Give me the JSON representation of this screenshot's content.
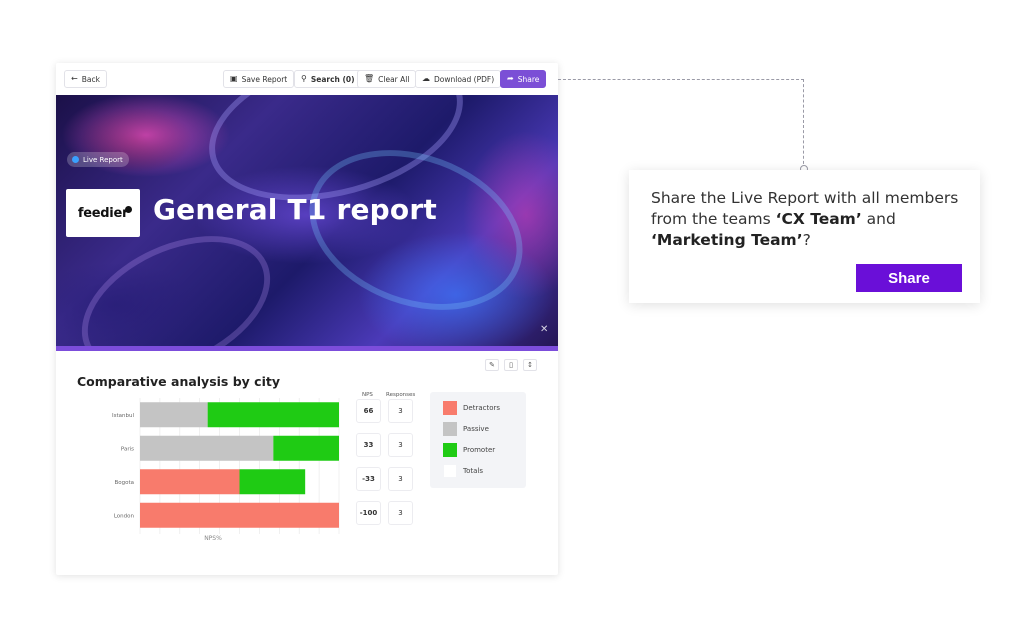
{
  "toolbar": {
    "back": "Back",
    "save_report": "Save Report",
    "search": "Search (0)",
    "clear_all": "Clear All",
    "download": "Download (PDF)",
    "share": "Share"
  },
  "hero": {
    "badge": "Live Report",
    "logo_text": "feedier",
    "title": "General T1 report"
  },
  "section": {
    "title": "Comparative analysis by city"
  },
  "chart_data": {
    "type": "bar",
    "stacked": true,
    "orientation": "horizontal",
    "categories": [
      "Istanbul",
      "Paris",
      "Bogota",
      "London"
    ],
    "series": [
      {
        "name": "Detractors",
        "color": "#f87b6c",
        "values": [
          0,
          0,
          50,
          100
        ]
      },
      {
        "name": "Passive",
        "color": "#c4c4c4",
        "values": [
          34,
          67,
          0,
          0
        ]
      },
      {
        "name": "Promoter",
        "color": "#1fcb14",
        "values": [
          66,
          33,
          33,
          0
        ]
      }
    ],
    "xlabel": "NPS%",
    "xlim": [
      0,
      100
    ],
    "grid": true
  },
  "table": {
    "nps_header": "NPS",
    "responses_header": "Responses",
    "rows": [
      {
        "nps": "66",
        "responses": "3"
      },
      {
        "nps": "33",
        "responses": "3"
      },
      {
        "nps": "-33",
        "responses": "3"
      },
      {
        "nps": "-100",
        "responses": "3"
      }
    ]
  },
  "legend": {
    "items": [
      {
        "label": "Detractors",
        "color": "#f87b6c"
      },
      {
        "label": "Passive",
        "color": "#c4c4c4"
      },
      {
        "label": "Promoter",
        "color": "#1fcb14"
      },
      {
        "label": "Totals",
        "color": "#ffffff"
      }
    ]
  },
  "modal": {
    "text_before": "Share the Live Report with all members from the teams ",
    "team1": "‘CX Team’",
    "text_mid": " and ",
    "team2": "‘Marketing Team’",
    "text_after": "?",
    "button": "Share"
  }
}
